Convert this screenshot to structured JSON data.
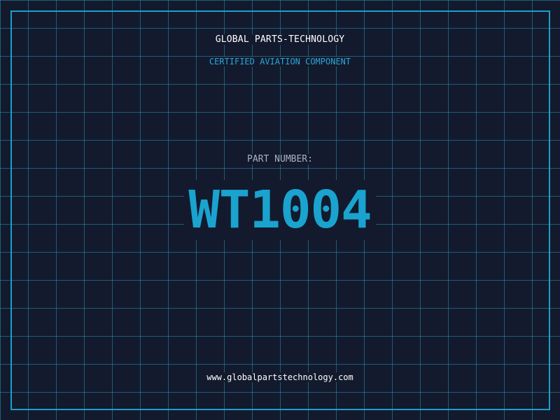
{
  "header": {
    "brand": "GLOBAL PARTS-TECHNOLOGY",
    "subtitle": "CERTIFIED AVIATION COMPONENT"
  },
  "part": {
    "label": "PART NUMBER:",
    "number": "WT1004"
  },
  "footer": {
    "url": "www.globalpartstechnology.com"
  },
  "colors": {
    "background": "#131a2d",
    "accent": "#1aa3cf",
    "grid": "#2696b4"
  }
}
